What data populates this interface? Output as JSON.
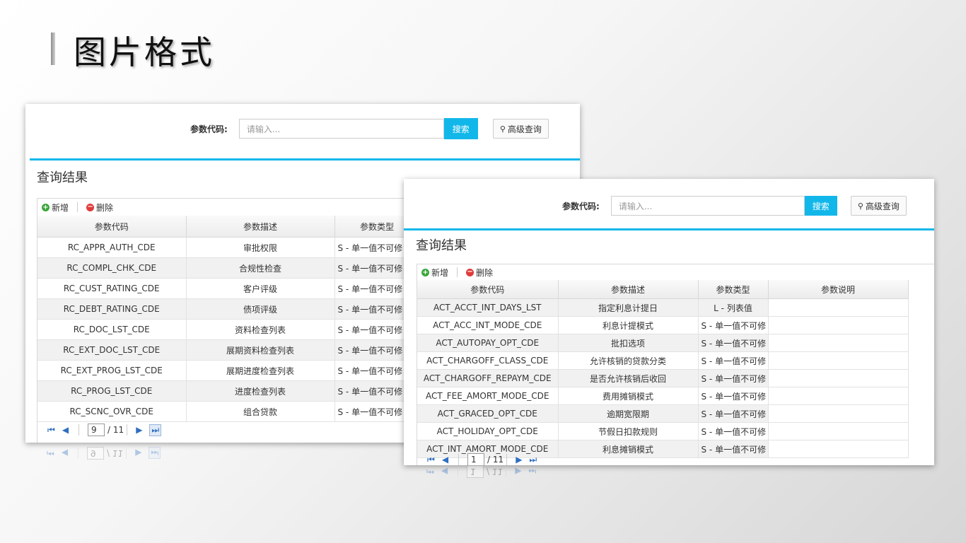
{
  "slide": {
    "title": "图片格式"
  },
  "panel1": {
    "search_label": "参数代码:",
    "search_placeholder": "请输入...",
    "search_button": "搜索",
    "advanced_button": "高级查询",
    "results_title": "查询结果",
    "toolbar": {
      "add": "新增",
      "delete": "删除"
    },
    "columns": [
      "参数代码",
      "参数描述",
      "参数类型"
    ],
    "rows": [
      [
        "RC_APPR_AUTH_CDE",
        "审批权限",
        "S - 单一值不可修"
      ],
      [
        "RC_COMPL_CHK_CDE",
        "合规性检查",
        "S - 单一值不可修"
      ],
      [
        "RC_CUST_RATING_CDE",
        "客户评级",
        "S - 单一值不可修"
      ],
      [
        "RC_DEBT_RATING_CDE",
        "债项评级",
        "S - 单一值不可修"
      ],
      [
        "RC_DOC_LST_CDE",
        "资料检查列表",
        "S - 单一值不可修"
      ],
      [
        "RC_EXT_DOC_LST_CDE",
        "展期资料检查列表",
        "S - 单一值不可修"
      ],
      [
        "RC_EXT_PROG_LST_CDE",
        "展期进度检查列表",
        "S - 单一值不可修"
      ],
      [
        "RC_PROG_LST_CDE",
        "进度检查列表",
        "S - 单一值不可修"
      ],
      [
        "RC_SCNC_OVR_CDE",
        "组合贷款",
        "S - 单一值不可修"
      ]
    ],
    "pager": {
      "page": "9",
      "total": "/ 11"
    }
  },
  "panel2": {
    "search_label": "参数代码:",
    "search_placeholder": "请输入...",
    "search_button": "搜索",
    "advanced_button": "高级查询",
    "results_title": "查询结果",
    "toolbar": {
      "add": "新增",
      "delete": "删除"
    },
    "columns": [
      "参数代码",
      "参数描述",
      "参数类型",
      "参数说明"
    ],
    "rows": [
      [
        "ACT_ACCT_INT_DAYS_LST",
        "指定利息计提日",
        "L - 列表值",
        ""
      ],
      [
        "ACT_ACC_INT_MODE_CDE",
        "利息计提模式",
        "S - 单一值不可修",
        ""
      ],
      [
        "ACT_AUTOPAY_OPT_CDE",
        "批扣选项",
        "S - 单一值不可修",
        ""
      ],
      [
        "ACT_CHARGOFF_CLASS_CDE",
        "允许核销的贷款分类",
        "S - 单一值不可修",
        ""
      ],
      [
        "ACT_CHARGOFF_REPAYM_CDE",
        "是否允许核销后收回",
        "S - 单一值不可修",
        ""
      ],
      [
        "ACT_FEE_AMORT_MODE_CDE",
        "费用摊销模式",
        "S - 单一值不可修",
        ""
      ],
      [
        "ACT_GRACED_OPT_CDE",
        "逾期宽限期",
        "S - 单一值不可修",
        ""
      ],
      [
        "ACT_HOLIDAY_OPT_CDE",
        "节假日扣款规则",
        "S - 单一值不可修",
        ""
      ],
      [
        "ACT_INT_AMORT_MODE_CDE",
        "利息摊销模式",
        "S - 单一值不可修",
        ""
      ]
    ],
    "pager": {
      "page": "1",
      "total": "/ 11"
    }
  },
  "icons": {
    "first": "⏮",
    "prev": "◀",
    "next": "▶",
    "last": "⏭",
    "search": "🔍",
    "add": "+",
    "delete": "−"
  },
  "colors": {
    "accent": "#12b7ea",
    "add": "#3aa63a",
    "delete": "#e03b3b"
  }
}
